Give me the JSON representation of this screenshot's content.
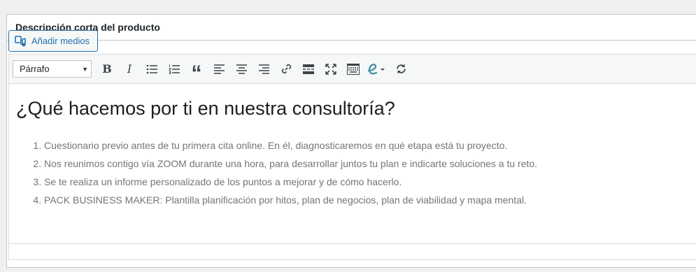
{
  "postbox": {
    "title": "Descripción corta del producto"
  },
  "media_button": {
    "label": "Añadir medios",
    "icon": "media-add-icon"
  },
  "toolbar": {
    "format_value": "Párrafo",
    "buttons": [
      {
        "name": "bold",
        "glyph": "B"
      },
      {
        "name": "italic",
        "glyph": "I"
      },
      {
        "name": "bullet-list"
      },
      {
        "name": "numbered-list"
      },
      {
        "name": "blockquote",
        "glyph": "“"
      },
      {
        "name": "align-left"
      },
      {
        "name": "align-center"
      },
      {
        "name": "align-right"
      },
      {
        "name": "link"
      },
      {
        "name": "read-more"
      },
      {
        "name": "fullscreen"
      },
      {
        "name": "toolbar-toggle"
      },
      {
        "name": "editor-switch"
      },
      {
        "name": "refresh"
      }
    ]
  },
  "content": {
    "heading": "¿Qué hacemos por ti en nuestra consultoría?",
    "items": [
      "Cuestionario previo antes de tu primera cita online. En él, diagnosticaremos en qué etapa está tu proyecto.",
      "Nos reunimos contigo vía ZOOM durante una hora, para desarrollar juntos tu plan e indicarte soluciones a tu reto.",
      "Se te realiza un informe personalizado de los puntos a mejorar y de cómo hacerlo.",
      "PACK BUSINESS MAKER: Plantilla planificación por hitos, plan de negocios, plan de viabilidad y mapa mental."
    ]
  },
  "colors": {
    "accent": "#2271b1",
    "editor_icon": "#3d8f9f"
  }
}
